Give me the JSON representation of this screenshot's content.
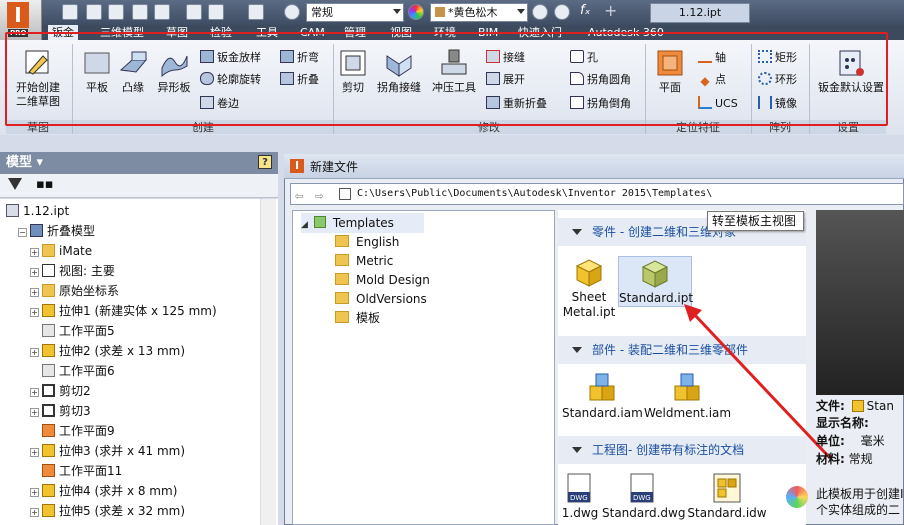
{
  "app": {
    "logo": "I",
    "edition": "PRO"
  },
  "quick_access": {
    "style_combo": "常规",
    "material_combo": "*黄色松木",
    "fx": "fₓ",
    "plus": "+",
    "file_tab": "1.12.ipt"
  },
  "tabs": [
    "钣金",
    "三维模型",
    "草图",
    "检验",
    "工具",
    "CAM",
    "管理",
    "视图",
    "环境",
    "BIM",
    "快速入门",
    "Autodesk 360"
  ],
  "ribbon": {
    "start_sketch": "开始创建\n二维草图",
    "start_sketch_line1": "开始创建",
    "start_sketch_line2": "二维草图",
    "face": "平板",
    "contour_flange": "凸缘",
    "contour_roll": "异形板",
    "lofted_flange": "钣金放样",
    "contour_roll2": "轮廓旋转",
    "hem": "卷边",
    "fold": "折弯",
    "fold2": "折叠",
    "cut": "剪切",
    "corner_seam": "拐角接缝",
    "punch": "冲压工具",
    "rip": "接缝",
    "unfold": "展开",
    "refold": "重新折叠",
    "hole": "孔",
    "corner_round": "拐角圆角",
    "corner_chamfer": "拐角倒角",
    "plane": "平面",
    "axis": "轴",
    "point": "点",
    "ucs": "UCS",
    "rect": "矩形",
    "circular": "环形",
    "mirror": "镜像",
    "defaults": "钣金默认设置",
    "groups": {
      "sketch": "草图",
      "create": "创建",
      "modify": "修改",
      "work": "定位特征",
      "pattern": "阵列",
      "setup": "设置"
    }
  },
  "panel": {
    "title": "模型",
    "help": "?",
    "tree": [
      {
        "label": "1.12.ipt",
        "indent": 0,
        "exp": "",
        "icon": "part"
      },
      {
        "label": "折叠模型",
        "indent": 1,
        "exp": "−",
        "icon": "sheetmetal"
      },
      {
        "label": "iMate",
        "indent": 2,
        "exp": "+",
        "icon": "folder"
      },
      {
        "label": "视图: 主要",
        "indent": 2,
        "exp": "+",
        "icon": "view"
      },
      {
        "label": "原始坐标系",
        "indent": 2,
        "exp": "+",
        "icon": "folder"
      },
      {
        "label": "拉伸1 (新建实体 x 125 mm)",
        "indent": 2,
        "exp": "+",
        "icon": "extrude"
      },
      {
        "label": "工作平面5",
        "indent": 2,
        "exp": "",
        "icon": "plane"
      },
      {
        "label": "拉伸2 (求差 x 13 mm)",
        "indent": 2,
        "exp": "+",
        "icon": "extrude"
      },
      {
        "label": "工作平面6",
        "indent": 2,
        "exp": "",
        "icon": "plane"
      },
      {
        "label": "剪切2",
        "indent": 2,
        "exp": "+",
        "icon": "cut"
      },
      {
        "label": "剪切3",
        "indent": 2,
        "exp": "+",
        "icon": "cut"
      },
      {
        "label": "工作平面9",
        "indent": 2,
        "exp": "",
        "icon": "plane-orange"
      },
      {
        "label": "拉伸3 (求并 x 41 mm)",
        "indent": 2,
        "exp": "+",
        "icon": "extrude"
      },
      {
        "label": "工作平面11",
        "indent": 2,
        "exp": "",
        "icon": "plane-orange"
      },
      {
        "label": "拉伸4 (求并 x 8 mm)",
        "indent": 2,
        "exp": "+",
        "icon": "extrude"
      },
      {
        "label": "拉伸5 (求差 x 32 mm)",
        "indent": 2,
        "exp": "+",
        "icon": "extrude"
      }
    ]
  },
  "dialog": {
    "title": "新建文件",
    "path": "C:\\Users\\Public\\Documents\\Autodesk\\Inventor 2015\\Templates\\",
    "folders": [
      "Templates",
      "English",
      "Metric",
      "Mold Design",
      "OldVersions",
      "模板"
    ],
    "tooltip": "转至模板主视图",
    "sections": [
      {
        "title": "零件 - 创建二维和三维对象"
      },
      {
        "title": "部件 - 装配二维和三维零部件"
      },
      {
        "title": "工程图- 创建带有标注的文档"
      }
    ],
    "part_files": [
      "Sheet\nMetal.ipt",
      "Standard.ipt"
    ],
    "part_file_1_line1": "Sheet",
    "part_file_1_line2": "Metal.ipt",
    "part_file_2": "Standard.ipt",
    "assembly_files": [
      "Standard.iam",
      "Weldment.iam"
    ],
    "drawing_files": [
      "1.dwg",
      "Standard.dwg",
      "Standard.idw"
    ],
    "dwg_tag": "DWG",
    "props": {
      "file_label": "文件:",
      "file_value": "Stan",
      "display_label": "显示名称:",
      "unit_label": "单位:",
      "unit_value": "毫米",
      "material_label": "材料:",
      "material_value": "常规"
    },
    "desc_line1": "此模板用于创建I",
    "desc_line2": "个实体组成的二"
  },
  "colors": {
    "annotation": "#e02020",
    "section_text": "#1a4fa0"
  }
}
